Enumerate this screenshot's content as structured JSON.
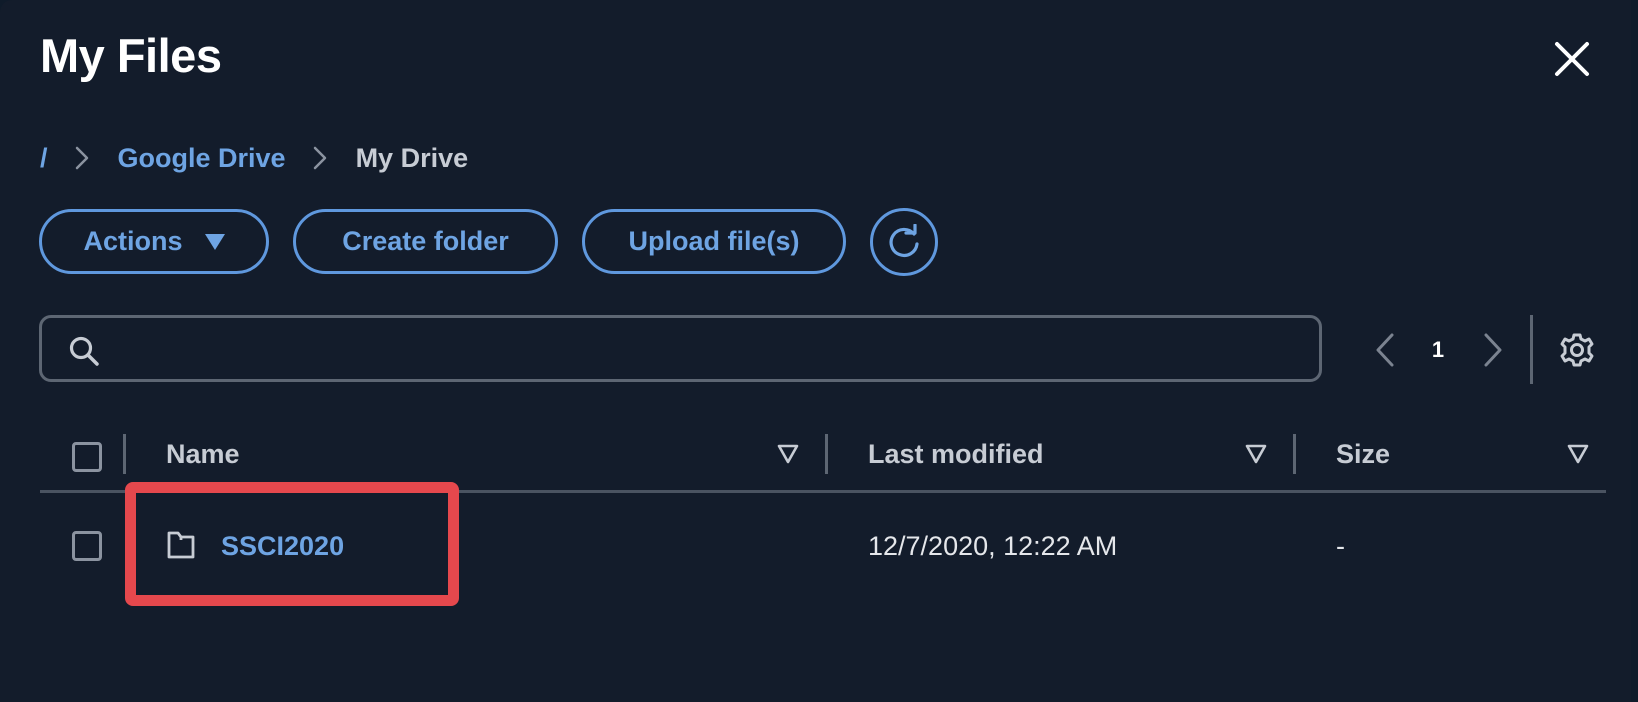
{
  "window": {
    "title": "My Files"
  },
  "icons": {
    "close": "close-icon",
    "chevron": "chevron-right-icon",
    "caret": "caret-down-icon",
    "refresh": "refresh-icon",
    "search": "search-icon",
    "prev": "chevron-left-icon",
    "next": "chevron-right-icon",
    "settings": "gear-icon",
    "sort": "sort-triangle-icon",
    "folder": "folder-icon"
  },
  "colors": {
    "background": "#131c2b",
    "accent": "#6ea4e3",
    "highlight": "#e5484d"
  },
  "breadcrumb": {
    "root": "/",
    "items": [
      "Google Drive",
      "My Drive"
    ]
  },
  "toolbar": {
    "actions_label": "Actions",
    "create_folder_label": "Create folder",
    "upload_label": "Upload file(s)"
  },
  "search": {
    "value": "",
    "placeholder": ""
  },
  "pagination": {
    "current_page": "1"
  },
  "table": {
    "columns": [
      "Name",
      "Last modified",
      "Size"
    ],
    "rows": [
      {
        "type": "folder",
        "name": "SSCI2020",
        "last_modified": "12/7/2020, 12:22 AM",
        "size": "-"
      }
    ]
  }
}
